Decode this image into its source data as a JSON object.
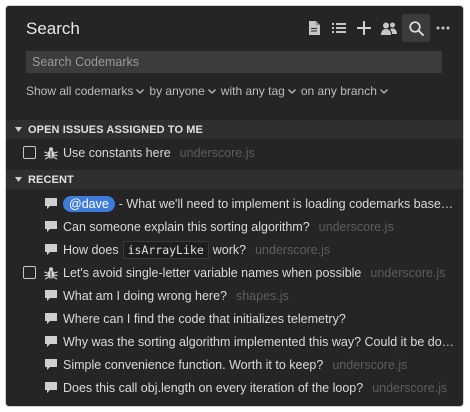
{
  "header": {
    "title": "Search",
    "toolbar": [
      {
        "name": "document-icon"
      },
      {
        "name": "list-icon"
      },
      {
        "name": "plus-icon"
      },
      {
        "name": "team-icon"
      },
      {
        "name": "search-icon",
        "active": true
      },
      {
        "name": "more-icon"
      }
    ]
  },
  "search": {
    "placeholder": "Search Codemarks",
    "value": ""
  },
  "filters": [
    {
      "label": "Show all codemarks"
    },
    {
      "label": "by anyone"
    },
    {
      "label": "with any tag"
    },
    {
      "label": "on any branch"
    }
  ],
  "sections": {
    "open_issues": {
      "label": "OPEN ISSUES ASSIGNED TO ME",
      "items": [
        {
          "type": "issue",
          "text": "Use constants here",
          "file": "underscore.js"
        }
      ]
    },
    "recent": {
      "label": "RECENT",
      "items": [
        {
          "type": "comment",
          "mention": "@dave",
          "text": " - What we'll need to implement is loading codemarks based on…",
          "file": ""
        },
        {
          "type": "comment",
          "text": "Can someone explain this sorting algorithm?",
          "file": "underscore.js"
        },
        {
          "type": "comment",
          "text_before": "How does",
          "code": "isArrayLike",
          "text_after": "work?",
          "file": "underscore.js"
        },
        {
          "type": "issue",
          "text": "Let's avoid single-letter variable names when possible",
          "file": "underscore.js"
        },
        {
          "type": "comment",
          "text": "What am I doing wrong here?",
          "file": "shapes.js"
        },
        {
          "type": "comment",
          "text": "Where can I find the code that initializes telemetry?",
          "file": ""
        },
        {
          "type": "comment",
          "text": "Why was the sorting algorithm implemented this way? Could it be done m…",
          "file": ""
        },
        {
          "type": "comment",
          "text": "Simple convenience function. Worth it to keep?",
          "file": "underscore.js"
        },
        {
          "type": "comment",
          "text": "Does this call obj.length on every iteration of the loop?",
          "file": "underscore.js"
        }
      ]
    }
  }
}
